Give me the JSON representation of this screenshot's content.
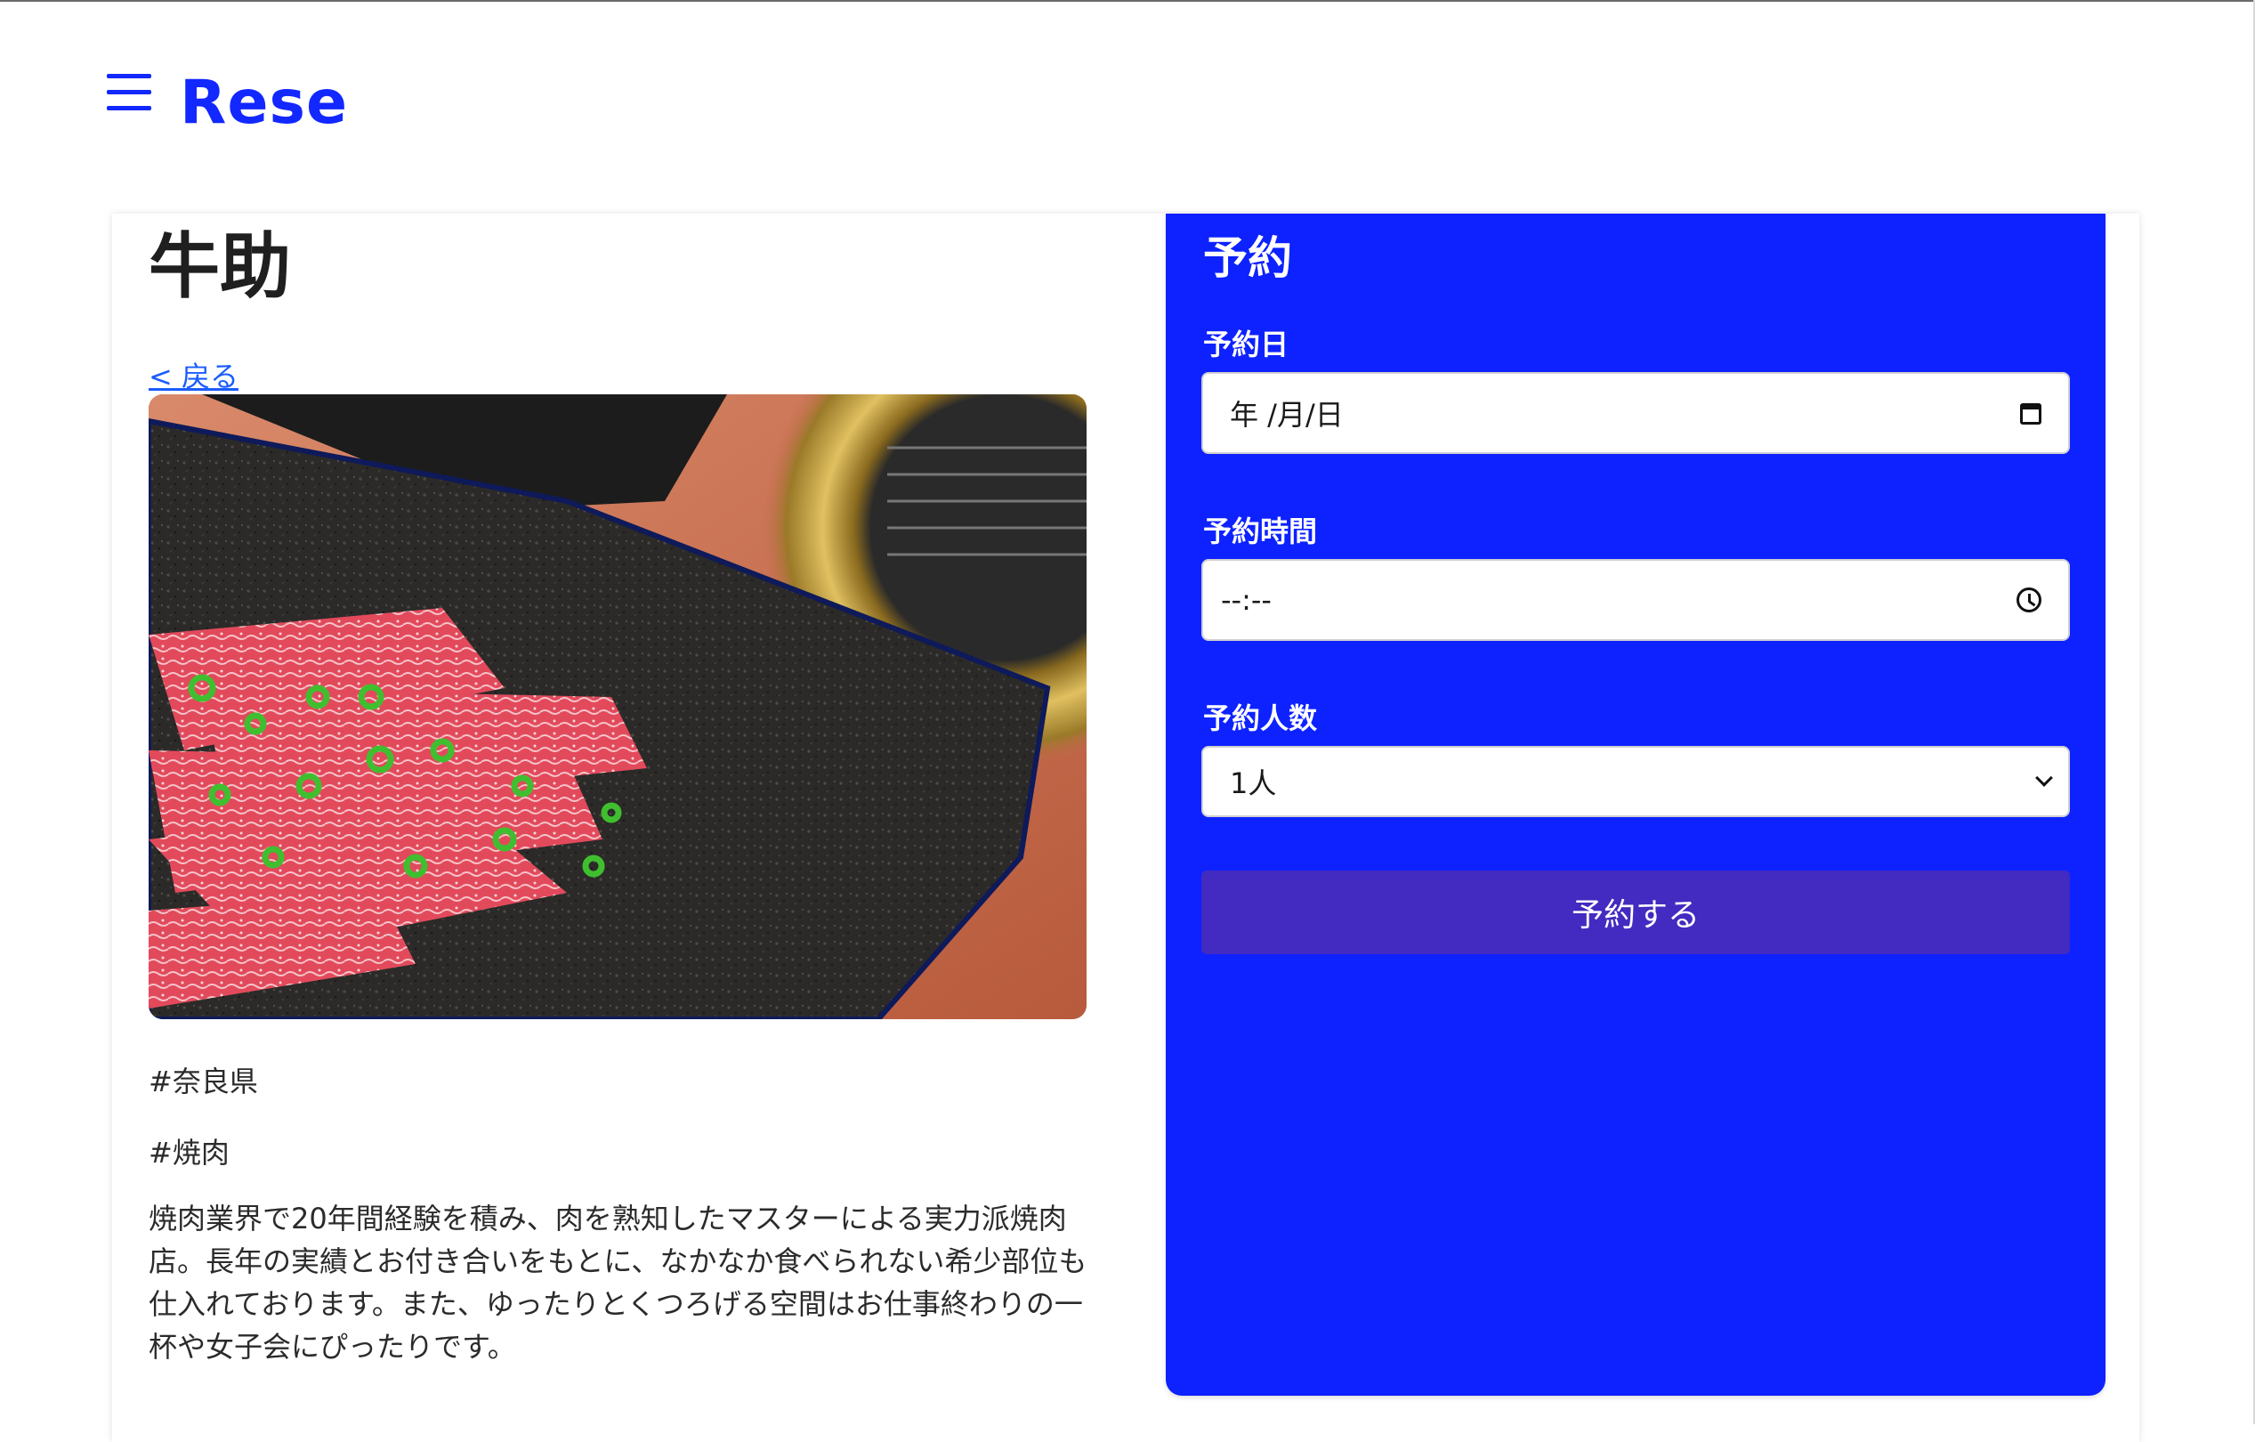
{
  "header": {
    "brand": "Rese",
    "menu_icon": "hamburger-menu-icon"
  },
  "shop": {
    "name": "牛助",
    "back_label": "< 戻る",
    "image_alt": "焼肉",
    "area_tag": "#奈良県",
    "genre_tag": "#焼肉",
    "description": "焼肉業界で20年間経験を積み、肉を熟知したマスターによる実力派焼肉店。長年の実績とお付き合いをもとに、なかなか食べられない希少部位も仕入れております。また、ゆったりとくつろげる空間はお仕事終わりの一杯や女子会にぴったりです。"
  },
  "reservation": {
    "title": "予約",
    "date_label": "予約日",
    "date_value": "年 /月/日",
    "time_label": "予約時間",
    "time_value": "--:--",
    "people_label": "予約人数",
    "people_value": "1人",
    "submit_label": "予約する"
  },
  "colors": {
    "accent": "#1228ff",
    "panel": "#0d22ff",
    "submit": "#432ac0",
    "link": "#1a5cff"
  }
}
